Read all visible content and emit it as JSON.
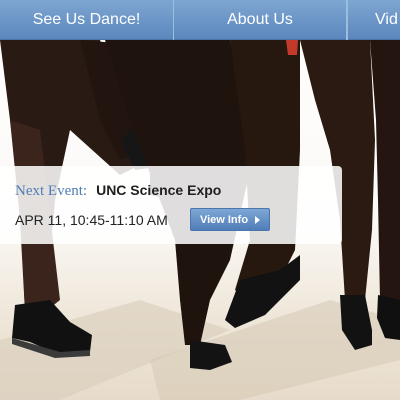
{
  "nav": {
    "items": [
      {
        "label": "See Us Dance!"
      },
      {
        "label": "About Us"
      },
      {
        "label": "Vid"
      }
    ]
  },
  "event": {
    "label": "Next Event:",
    "name": "UNC Science Expo",
    "time": "APR 11, 10:45-11:10 AM",
    "button_label": "View Info"
  },
  "colors": {
    "nav_accent": "#5b87bd",
    "event_label": "#4f7db5",
    "button": "#4f7db9"
  }
}
